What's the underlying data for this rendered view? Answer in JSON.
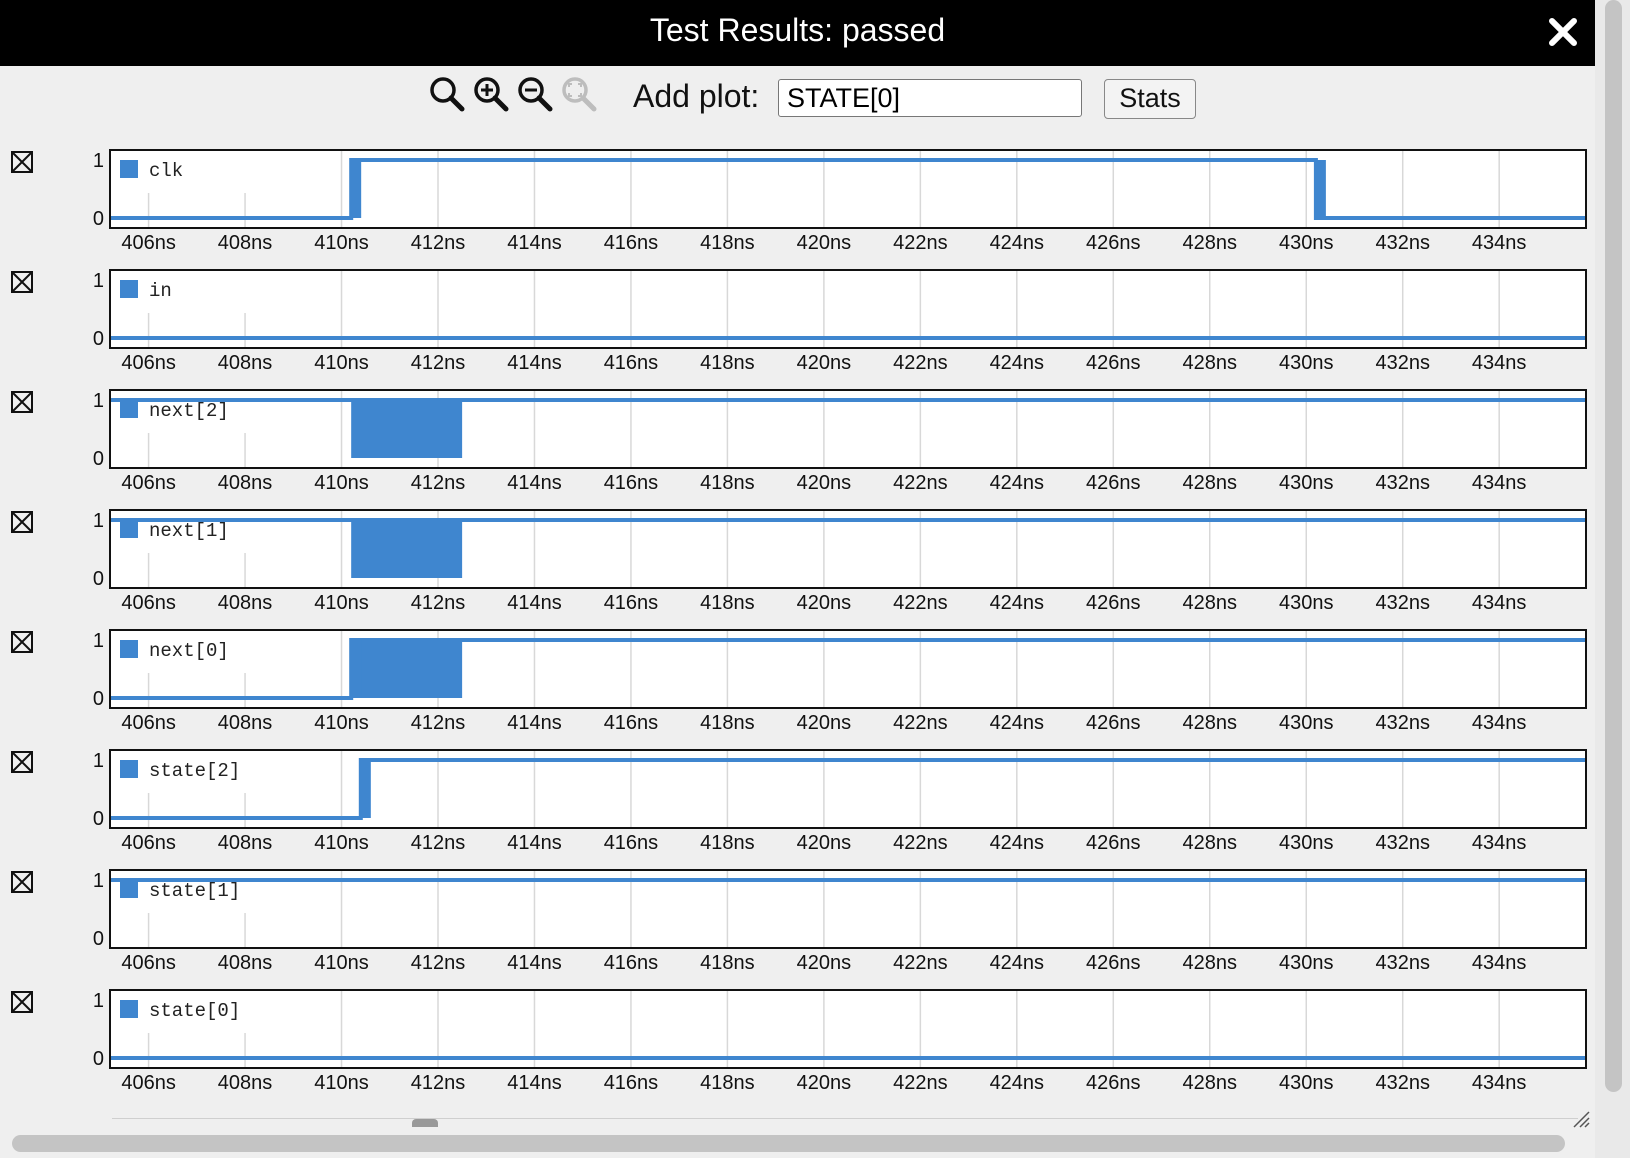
{
  "window": {
    "title": "Test Results: passed"
  },
  "toolbar": {
    "tools": [
      {
        "name": "zoom-reset-icon",
        "enabled": true
      },
      {
        "name": "zoom-in-icon",
        "enabled": true
      },
      {
        "name": "zoom-out-icon",
        "enabled": true
      },
      {
        "name": "zoom-fit-icon",
        "enabled": false
      }
    ],
    "add_plot_label": "Add plot:",
    "add_plot_value": "STATE[0]",
    "stats_label": "Stats"
  },
  "colors": {
    "signal": "#3f86cf",
    "grid": "#d8d8d8",
    "titlebar": "#000000"
  },
  "plots": [
    {
      "name": "clk",
      "y_ticks": [
        "1",
        "0"
      ]
    },
    {
      "name": "in",
      "y_ticks": [
        "1",
        "0"
      ]
    },
    {
      "name": "next[2]",
      "y_ticks": [
        "1",
        "0"
      ]
    },
    {
      "name": "next[1]",
      "y_ticks": [
        "1",
        "0"
      ]
    },
    {
      "name": "next[0]",
      "y_ticks": [
        "1",
        "0"
      ]
    },
    {
      "name": "state[2]",
      "y_ticks": [
        "1",
        "0"
      ]
    },
    {
      "name": "state[1]",
      "y_ticks": [
        "1",
        "0"
      ]
    },
    {
      "name": "state[0]",
      "y_ticks": [
        "1",
        "0"
      ]
    }
  ],
  "chart_data": {
    "type": "line",
    "title": "",
    "xlabel": "",
    "ylabel": "",
    "x_tick_labels": [
      "406ns",
      "408ns",
      "410ns",
      "412ns",
      "414ns",
      "416ns",
      "418ns",
      "420ns",
      "422ns",
      "424ns",
      "426ns",
      "428ns",
      "430ns",
      "432ns",
      "434ns"
    ],
    "x_ticks": [
      406,
      408,
      410,
      412,
      414,
      416,
      418,
      420,
      422,
      424,
      426,
      428,
      430,
      432,
      434
    ],
    "xlim": [
      405.2,
      435.8
    ],
    "ylim": [
      0,
      1
    ],
    "grid": true,
    "legend_placement": "top-left",
    "series": [
      {
        "name": "clk",
        "points": [
          [
            405.2,
            0
          ],
          [
            410.2,
            0
          ],
          [
            410.2,
            1
          ],
          [
            430.2,
            1
          ],
          [
            430.2,
            0
          ],
          [
            435.8,
            0
          ]
        ],
        "unknown": []
      },
      {
        "name": "in",
        "points": [
          [
            405.2,
            0
          ],
          [
            435.8,
            0
          ]
        ],
        "unknown": []
      },
      {
        "name": "next[2]",
        "points": [
          [
            405.2,
            1
          ],
          [
            435.8,
            1
          ]
        ],
        "unknown": [
          [
            410.2,
            412.5
          ]
        ]
      },
      {
        "name": "next[1]",
        "points": [
          [
            405.2,
            1
          ],
          [
            435.8,
            1
          ]
        ],
        "unknown": [
          [
            410.2,
            412.5
          ]
        ]
      },
      {
        "name": "next[0]",
        "points": [
          [
            405.2,
            0
          ],
          [
            410.2,
            0
          ],
          [
            410.2,
            1
          ],
          [
            435.8,
            1
          ]
        ],
        "unknown": [
          [
            410.2,
            412.5
          ]
        ]
      },
      {
        "name": "state[2]",
        "points": [
          [
            405.2,
            0
          ],
          [
            410.4,
            0
          ],
          [
            410.4,
            1
          ],
          [
            435.8,
            1
          ]
        ],
        "unknown": []
      },
      {
        "name": "state[1]",
        "points": [
          [
            405.2,
            1
          ],
          [
            435.8,
            1
          ]
        ],
        "unknown": []
      },
      {
        "name": "state[0]",
        "points": [
          [
            405.2,
            0
          ],
          [
            435.8,
            0
          ]
        ],
        "unknown": []
      }
    ]
  }
}
